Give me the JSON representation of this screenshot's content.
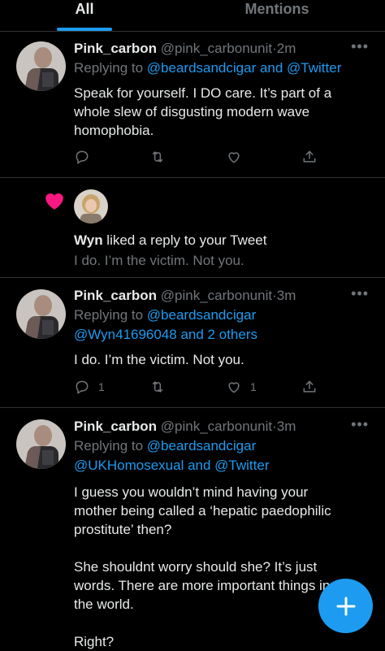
{
  "tabs": [
    {
      "label": "All",
      "active": true
    },
    {
      "label": "Mentions",
      "active": false
    }
  ],
  "tweets": [
    {
      "name": "Pink_carbon",
      "handle": "@pink_carbonunit",
      "time": "2m",
      "replying_prefix": "Replying to ",
      "replying_line1": "@beardsandcigar and @Twitter",
      "replying_line2": "",
      "text": [
        "Speak for yourself. I DO care. It’s part of a",
        "whole slew of disgusting modern wave",
        "homophobia."
      ],
      "reply_count": "",
      "like_count": ""
    },
    {
      "name": "Pink_carbon",
      "handle": "@pink_carbonunit",
      "time": "3m",
      "replying_prefix": "Replying to ",
      "replying_line1": "@beardsandcigar",
      "replying_line2": "@Wyn41696048 and 2 others",
      "text": [
        "I do. I’m the victim. Not you."
      ],
      "reply_count": "1",
      "like_count": "1"
    },
    {
      "name": "Pink_carbon",
      "handle": "@pink_carbonunit",
      "time": "3m",
      "replying_prefix": "Replying to ",
      "replying_line1": "@beardsandcigar",
      "replying_line2": "@UKHomosexual and @Twitter",
      "text": [
        "I guess you wouldn’t mind having your",
        "mother being called a ‘hepatic paedophilic",
        "prostitute’ then?",
        "",
        "She shouldnt worry should she? It’s just",
        "words. There are more important things in",
        "the world.",
        "",
        "Right?"
      ]
    }
  ],
  "notification": {
    "user": "Wyn",
    "action": " liked a reply to your Tweet",
    "quoted": "I do. I’m the victim. Not you.",
    "icon": "heart-icon",
    "icon_color": "#f91880"
  },
  "colors": {
    "accent": "#1d9bf0",
    "muted": "#71767b",
    "background": "#000000"
  }
}
